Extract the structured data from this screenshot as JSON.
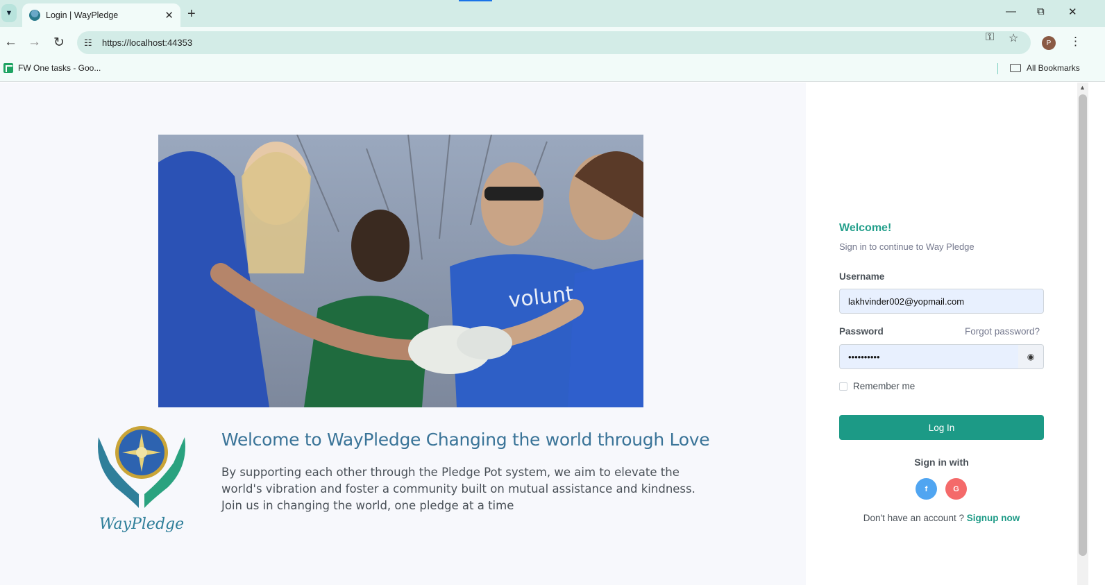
{
  "browser": {
    "tab_title": "Login | WayPledge",
    "url": "https://localhost:44353",
    "profile_initial": "P",
    "bookmark_item": "FW One tasks - Goo...",
    "all_bookmarks": "All Bookmarks"
  },
  "hero": {
    "headline": "Welcome to WayPledge Changing the world through Love",
    "description": "By supporting each other through the Pledge Pot system, we aim to elevate the world's vibration and foster a community built on mutual assistance and kindness. Join us in changing the world, one pledge at a time",
    "logo_text": "WayPledge",
    "photo_shirt_text": "voluntee"
  },
  "login": {
    "welcome": "Welcome!",
    "subtitle": "Sign in to continue to Way Pledge",
    "username_label": "Username",
    "username_value": "lakhvinder002@yopmail.com",
    "password_label": "Password",
    "password_value": "••••••••••",
    "forgot": "Forgot password?",
    "remember": "Remember me",
    "login_button": "Log In",
    "sign_in_with": "Sign in with",
    "facebook_glyph": "f",
    "google_glyph": "G",
    "no_account": "Don't have an account ? ",
    "signup": "Signup now"
  },
  "colors": {
    "brand_teal": "#1c9a86",
    "headline_blue": "#3a7498"
  }
}
